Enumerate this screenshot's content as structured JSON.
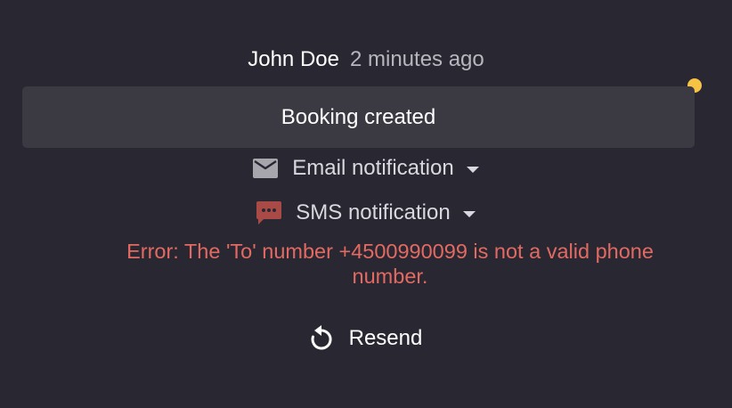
{
  "activity": {
    "author": "John Doe",
    "time": "2 minutes ago",
    "unread_color": "#f6c344",
    "event_label": "Booking created"
  },
  "notifications": [
    {
      "label": "Email notification",
      "icon": "email-icon",
      "status": "ok"
    },
    {
      "label": "SMS notification",
      "icon": "sms-icon",
      "status": "error",
      "icon_color": "#a94a47"
    }
  ],
  "error": {
    "message": "Error: The 'To' number +4500990099 is not a valid phone number.",
    "color": "#e36a62"
  },
  "actions": {
    "resend_label": "Resend",
    "resend_icon": "refresh-icon"
  }
}
